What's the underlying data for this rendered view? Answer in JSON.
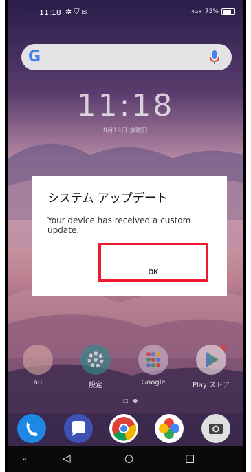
{
  "status_bar": {
    "time": "11:18",
    "network": "4G+",
    "battery": "75%"
  },
  "search": {
    "logo": "G",
    "mic_icon": "mic-icon"
  },
  "lock_clock": {
    "time": "11:18",
    "date": "8月19日 水曜日"
  },
  "dialog": {
    "title": "システム アップデート",
    "message": "Your device has received a custom update.",
    "ok_label": "OK"
  },
  "apps": [
    {
      "label": "au",
      "icon": "au-icon"
    },
    {
      "label": "設定",
      "icon": "gear-icon"
    },
    {
      "label": "Google",
      "icon": "google-folder-icon"
    },
    {
      "label": "Play ストア",
      "icon": "play-store-icon"
    }
  ],
  "dock": [
    "phone-icon",
    "messages-icon",
    "chrome-icon",
    "photos-icon",
    "camera-icon"
  ],
  "colors": {
    "highlight": "#ee1b2e",
    "accent": "#4285f4"
  }
}
